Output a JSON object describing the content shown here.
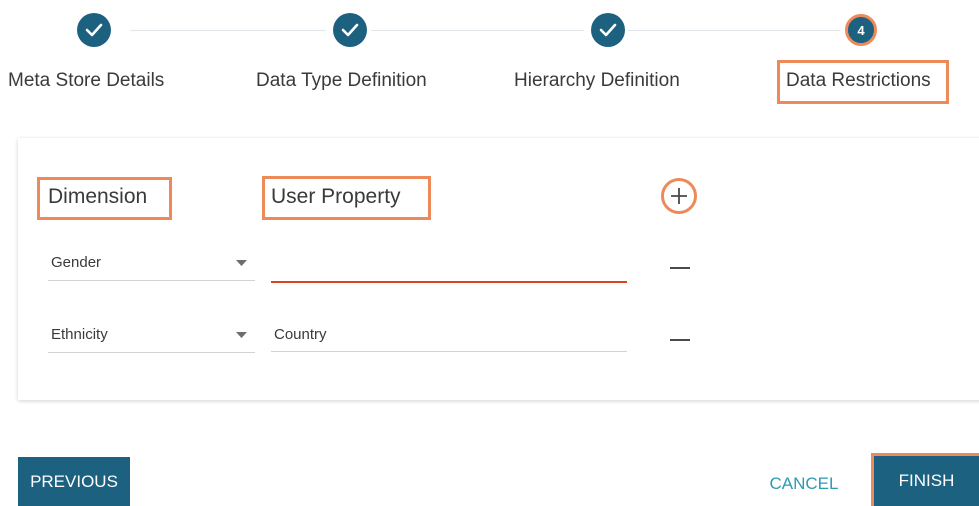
{
  "stepper": {
    "steps": [
      {
        "label": "Meta Store Details",
        "state": "done",
        "icon": "check-icon"
      },
      {
        "label": "Data Type Definition",
        "state": "done",
        "icon": "check-icon"
      },
      {
        "label": "Hierarchy Definition",
        "state": "done",
        "icon": "check-icon"
      },
      {
        "label": "Data Restrictions",
        "state": "current",
        "number": "4"
      }
    ]
  },
  "restrictions": {
    "dimension_header": "Dimension",
    "user_property_header": "User Property",
    "add_icon": "plus-icon",
    "remove_icon": "minus-icon",
    "rows": [
      {
        "dimension": "Gender",
        "user_property": ""
      },
      {
        "dimension": "Ethnicity",
        "user_property": "Country"
      }
    ]
  },
  "footer": {
    "previous_label": "PREVIOUS",
    "cancel_label": "CANCEL",
    "finish_label": "FINISH"
  },
  "colors": {
    "primary": "#1d6180",
    "highlight": "#ee8a5a",
    "link": "#2f9ab2",
    "active_underline": "#d64621"
  }
}
